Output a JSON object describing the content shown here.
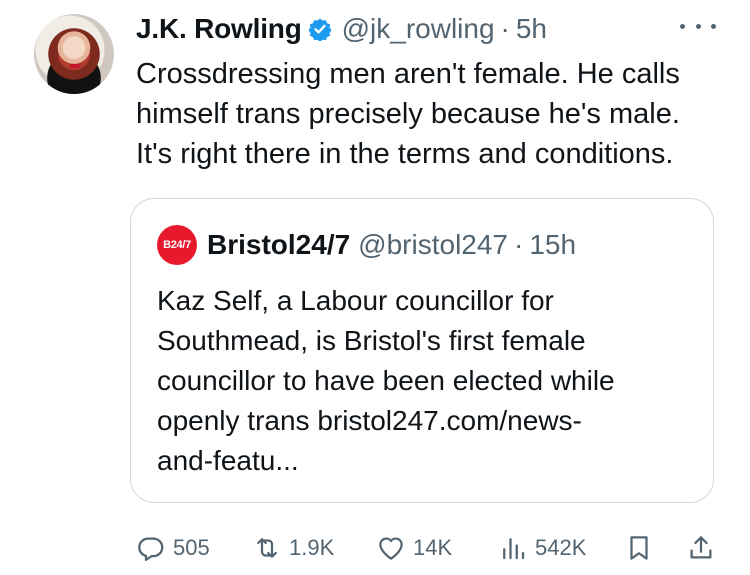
{
  "tweet": {
    "author_name": "J.K. Rowling",
    "handle": "@jk_rowling",
    "separator": "·",
    "time": "5h",
    "lines": [
      "Crossdressing men aren't female. He calls",
      "himself trans precisely because he's male.",
      "It's right there in the terms and conditions."
    ]
  },
  "quote": {
    "logo_text": "B24/7",
    "name": "Bristol24/7",
    "handle": "@bristol247",
    "separator": "·",
    "time": "15h",
    "lines": [
      "Kaz Self, a Labour councillor for",
      "Southmead, is Bristol's first female",
      "councillor to have been elected while",
      "openly trans bristol247.com/news-",
      "and-featu..."
    ]
  },
  "actions": {
    "replies": "505",
    "reposts": "1.9K",
    "likes": "14K",
    "views": "542K"
  },
  "colors": {
    "verified": "#1d9bf0",
    "secondary_text": "#536471",
    "logo_bg": "#e8192c"
  }
}
